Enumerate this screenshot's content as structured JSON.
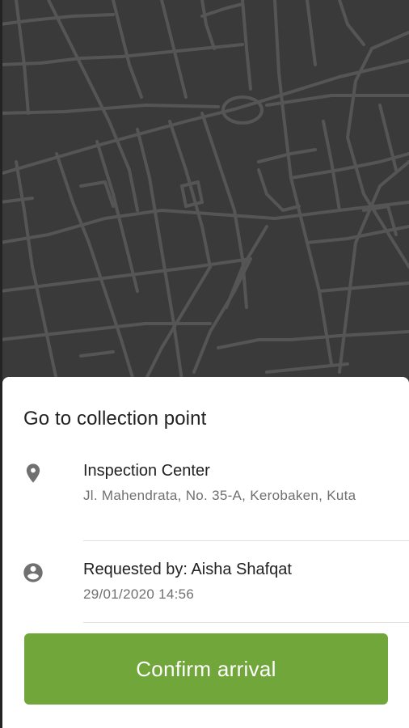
{
  "sheet": {
    "title": "Go to collection point",
    "location": {
      "icon": "location-pin-icon",
      "name": "Inspection Center",
      "address": "Jl. Mahendrata, No. 35-A, Kerobaken, Kuta"
    },
    "request": {
      "icon": "account-circle-icon",
      "requested_by": "Requested by: Aisha Shafqat",
      "datetime": "29/01/2020 14:56"
    },
    "confirm_label": "Confirm arrival"
  },
  "colors": {
    "map_background": "#3a3a3a",
    "map_roads": "#555555",
    "accent": "#71a73a",
    "icon": "#707070"
  }
}
